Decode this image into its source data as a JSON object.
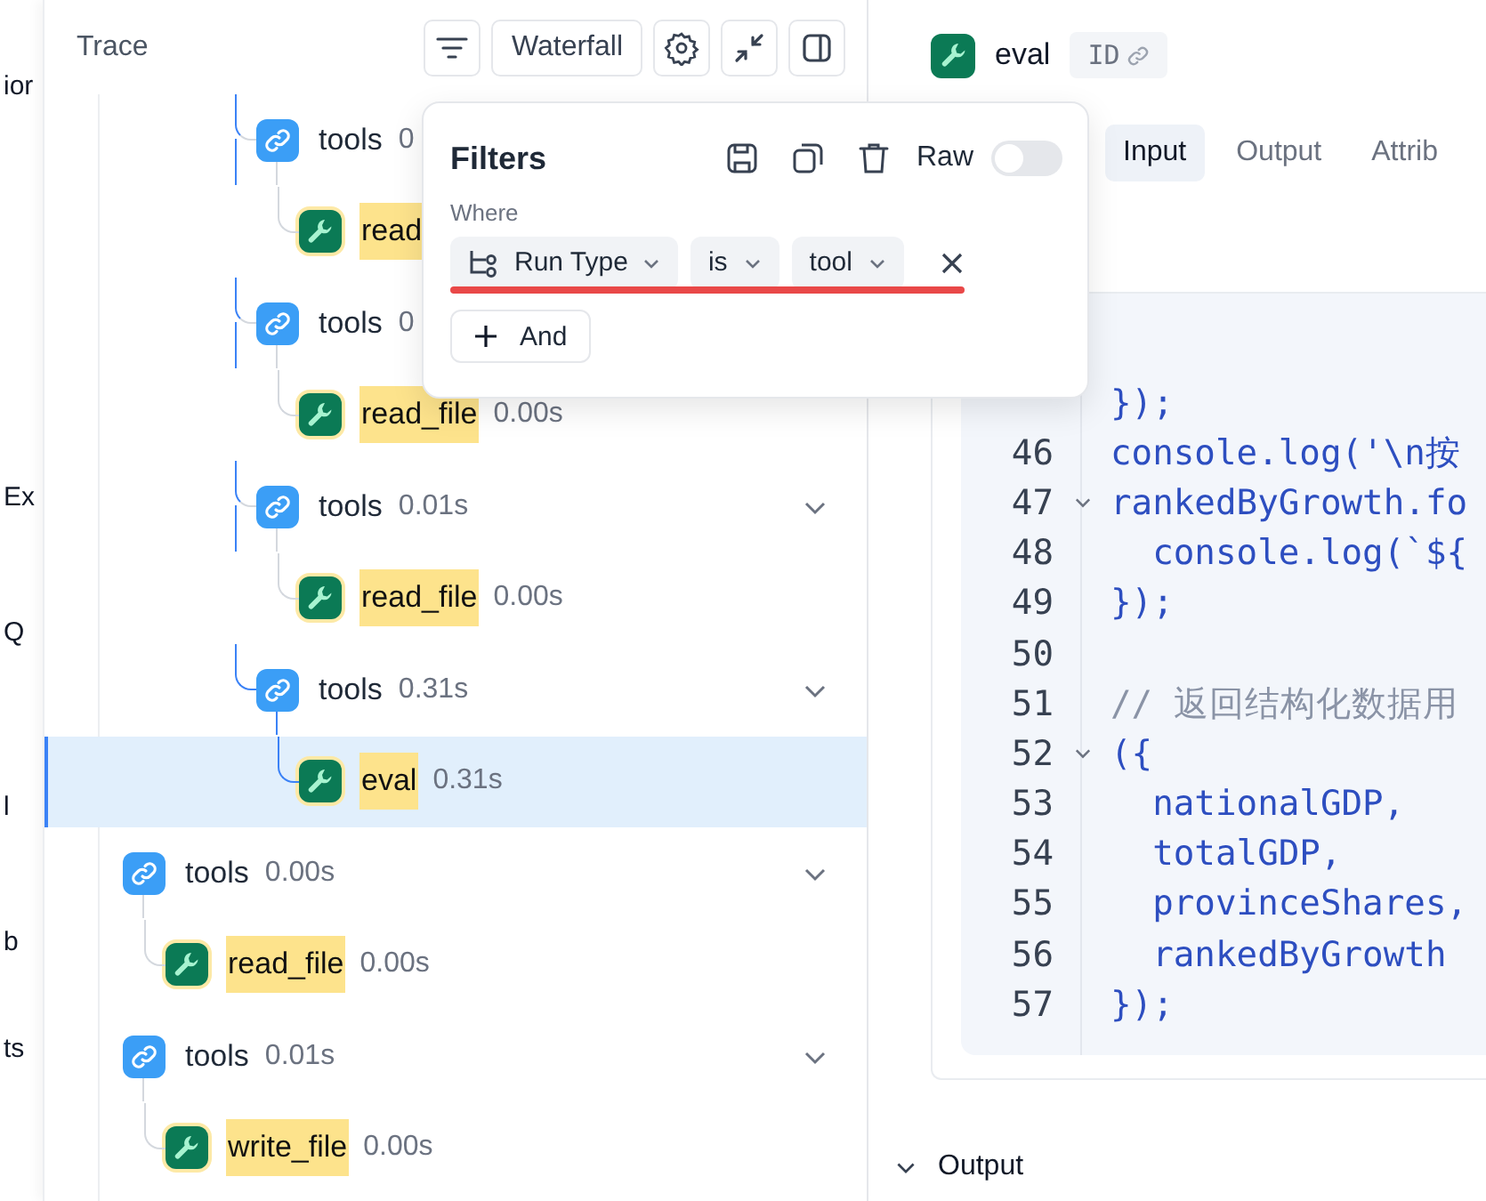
{
  "sidebar": {
    "items": [
      {
        "label": "ior"
      },
      {
        "label": "Ex"
      },
      {
        "label": "Q"
      },
      {
        "label": "l"
      },
      {
        "label": "b"
      },
      {
        "label": "ts"
      }
    ]
  },
  "trace": {
    "title": "Trace",
    "view_button": "Waterfall"
  },
  "tree": [
    {
      "children": [
        {
          "kind": "chain",
          "name": "tools",
          "time": "0",
          "selected": false,
          "children": [
            {
              "kind": "tool",
              "name": "read",
              "selected": false
            }
          ]
        },
        {
          "kind": "chain",
          "name": "tools",
          "time": "0",
          "selected": false,
          "children": [
            {
              "kind": "tool",
              "name": "read_file",
              "time": "0.00s",
              "selected": false
            }
          ]
        },
        {
          "kind": "chain",
          "name": "tools",
          "time": "0.01s",
          "selected": false,
          "expanded": true,
          "children": [
            {
              "kind": "tool",
              "name": "read_file",
              "time": "0.00s",
              "selected": false
            }
          ]
        },
        {
          "kind": "chain",
          "name": "tools",
          "time": "0.31s",
          "selected": false,
          "expanded": true,
          "children": [
            {
              "kind": "tool",
              "name": "eval",
              "time": "0.31s",
              "selected": true
            }
          ]
        }
      ]
    },
    {
      "kind": "chain",
      "name": "tools",
      "time": "0.00s",
      "selected": false,
      "expanded": true,
      "children": [
        {
          "kind": "tool",
          "name": "read_file",
          "time": "0.00s",
          "selected": false
        }
      ]
    },
    {
      "kind": "chain",
      "name": "tools",
      "time": "0.01s",
      "selected": false,
      "expanded": true,
      "children": [
        {
          "kind": "tool",
          "name": "write_file",
          "time": "0.00s",
          "selected": false
        }
      ]
    }
  ],
  "filters": {
    "title": "Filters",
    "raw": {
      "label": "Raw",
      "on": false
    },
    "where_label": "Where",
    "conditions": [
      {
        "kind": "field",
        "label": "Run Type"
      },
      {
        "kind": "operator",
        "label": "is"
      },
      {
        "kind": "value",
        "label": "tool"
      }
    ],
    "add_button": "And"
  },
  "detail": {
    "name": "eval",
    "id_badge": "ID",
    "tabs": [
      {
        "label": "Input",
        "selected": true
      },
      {
        "label": "Output",
        "selected": false
      },
      {
        "label": "Attrib",
        "selected": false
      }
    ],
    "code": [
      {
        "text": "});"
      },
      {
        "line": "46",
        "text": "console.log('\\n按"
      },
      {
        "line": "47",
        "text": "rankedByGrowth.fo",
        "foldable": true
      },
      {
        "line": "48",
        "text": "  console.log(`${"
      },
      {
        "line": "49",
        "text": "});"
      },
      {
        "line": "50"
      },
      {
        "line": "51",
        "text": "// 返回结构化数据用",
        "kind": "comment"
      },
      {
        "line": "52",
        "text": "({",
        "foldable": true
      },
      {
        "line": "53",
        "text": "  nationalGDP,"
      },
      {
        "line": "54",
        "text": "  totalGDP,"
      },
      {
        "line": "55",
        "text": "  provinceShares,"
      },
      {
        "line": "56",
        "text": "  rankedByGrowth"
      },
      {
        "line": "57",
        "text": "});"
      }
    ],
    "output_section": {
      "label": "Output",
      "expanded": true
    }
  }
}
